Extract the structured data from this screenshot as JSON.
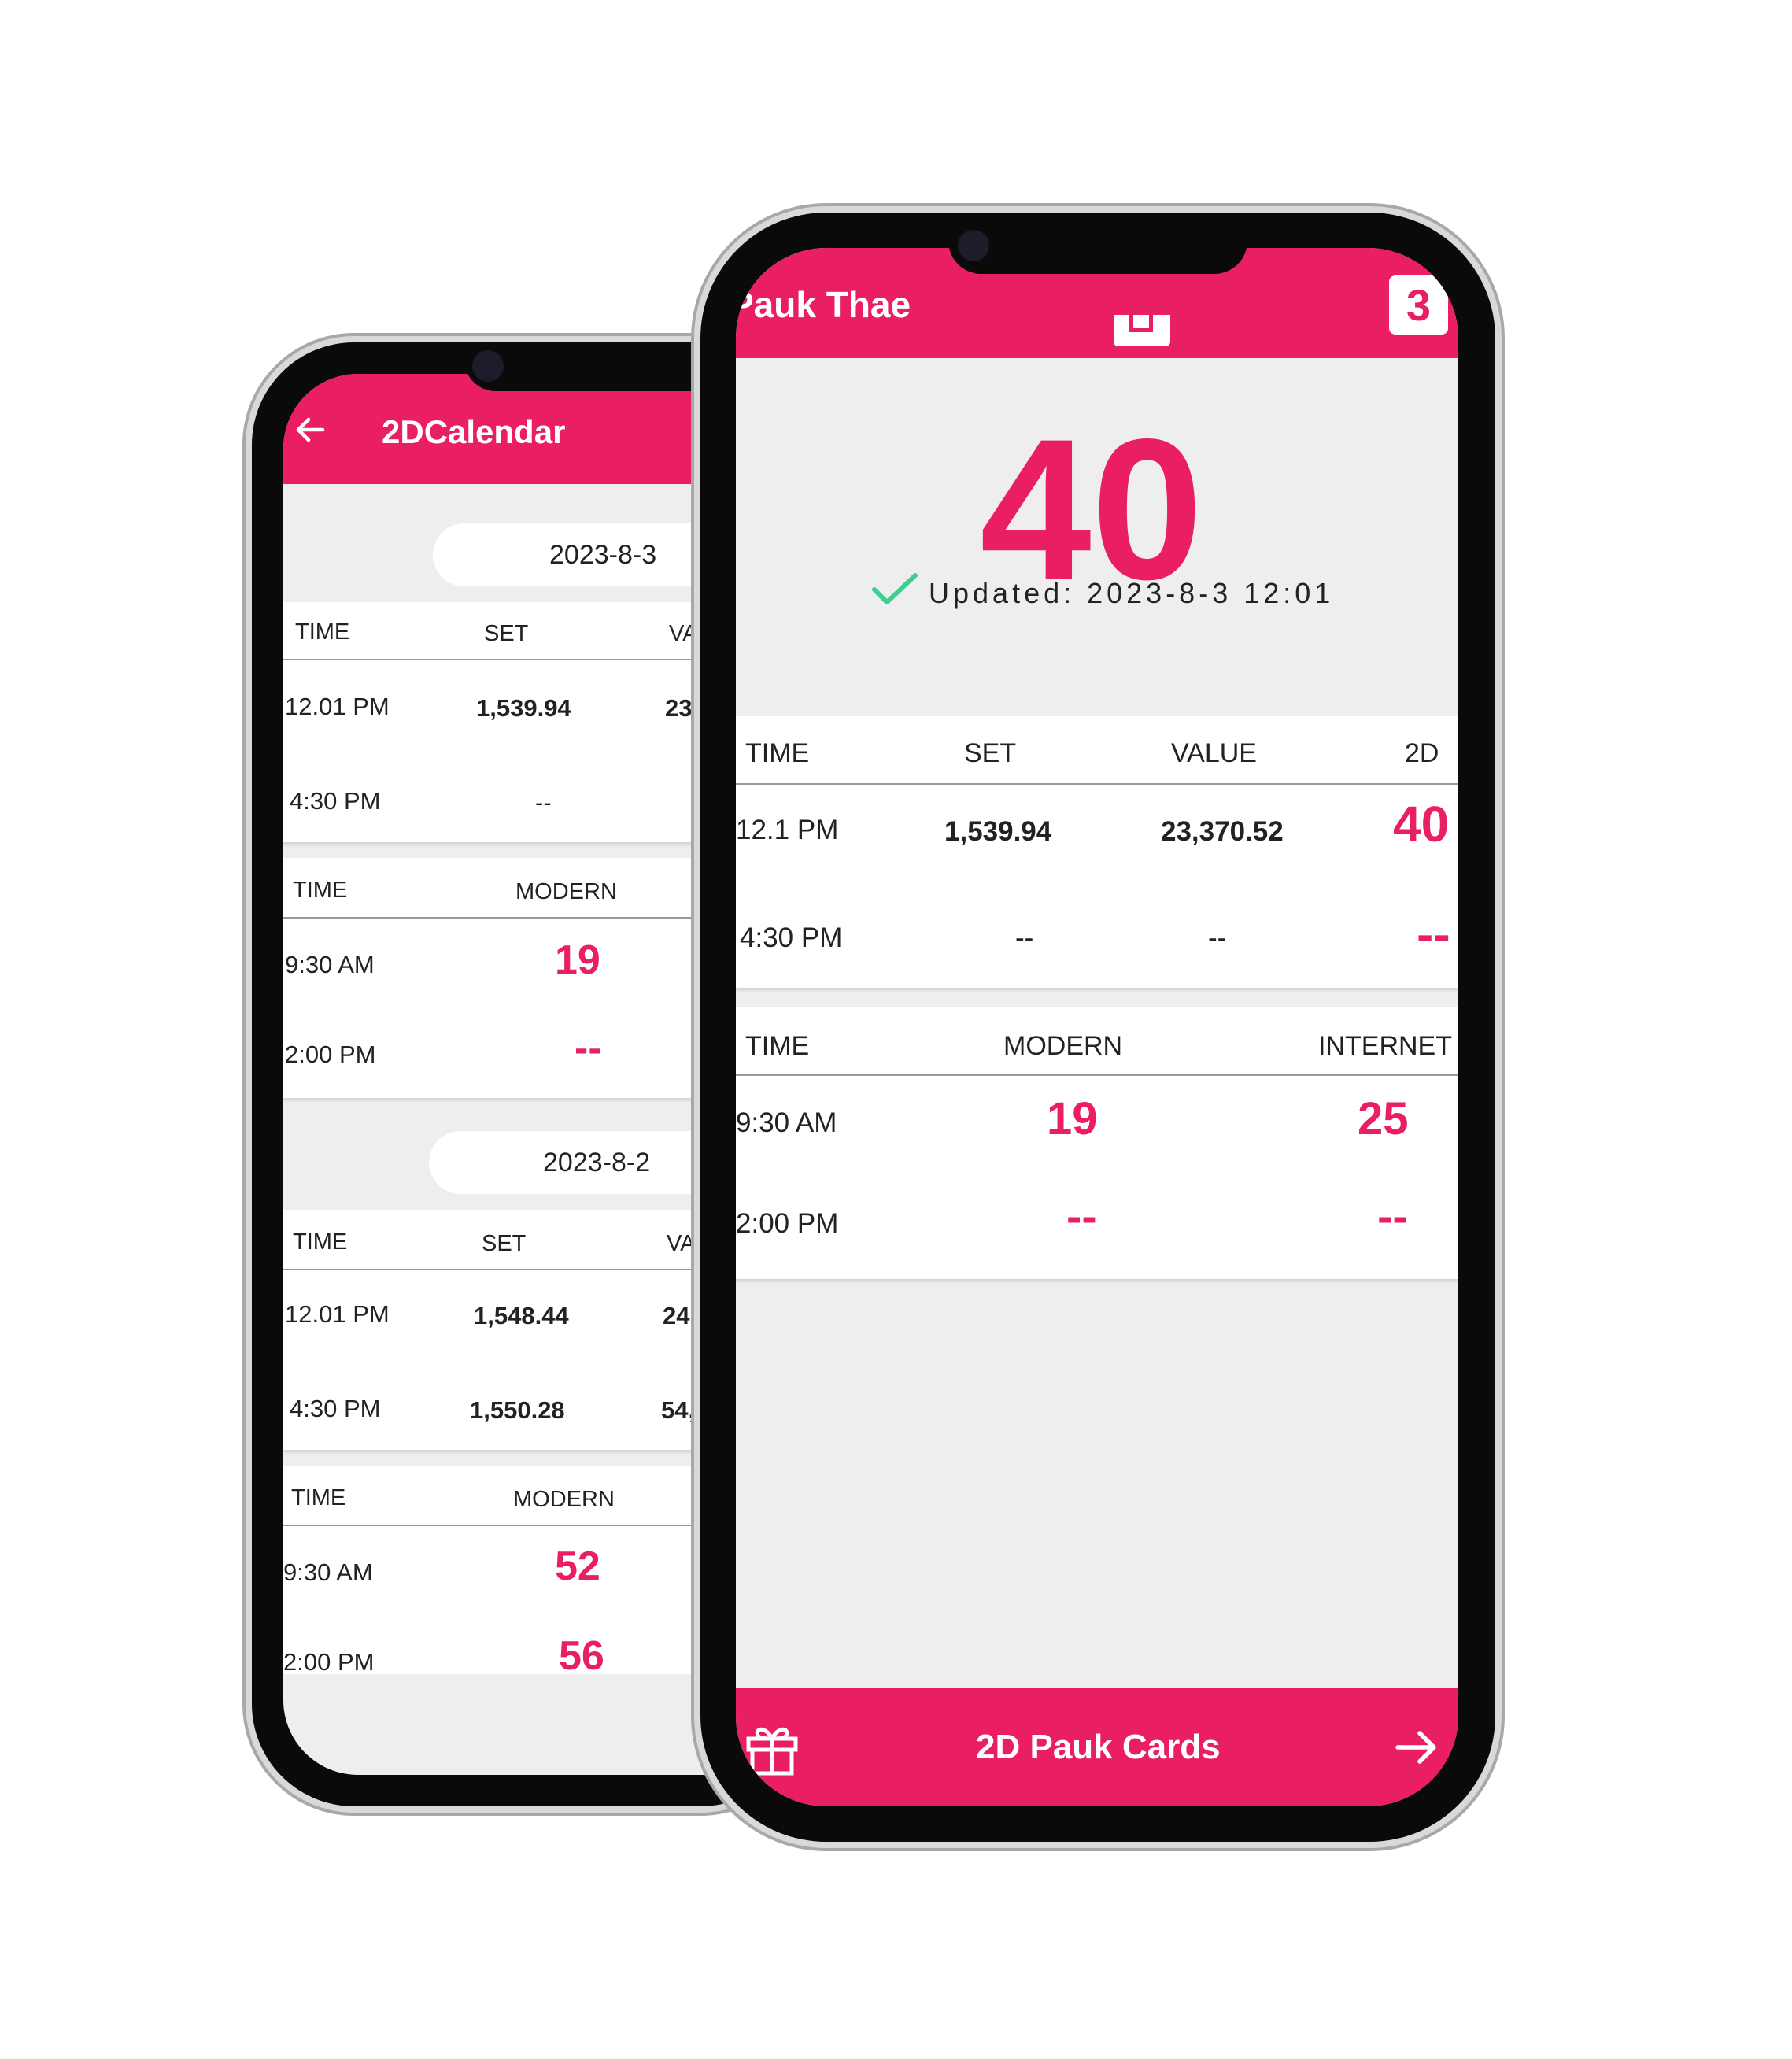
{
  "back_screen": {
    "title": "2DCalendar",
    "days": [
      {
        "date": "2023-8-3",
        "set_headers": [
          "TIME",
          "SET",
          "VA"
        ],
        "set_rows": [
          {
            "time": "12.01 PM",
            "set": "1,539.94",
            "value": "23"
          },
          {
            "time": "4:30 PM",
            "set": "--",
            "value": ""
          }
        ],
        "modern_headers": [
          "TIME",
          "MODERN"
        ],
        "modern_rows": [
          {
            "time": "9:30 AM",
            "modern": "19"
          },
          {
            "time": "2:00 PM",
            "modern": "--"
          }
        ]
      },
      {
        "date": "2023-8-2",
        "set_headers": [
          "TIME",
          "SET",
          "VA"
        ],
        "set_rows": [
          {
            "time": "12.01 PM",
            "set": "1,548.44",
            "value": "24,"
          },
          {
            "time": "4:30 PM",
            "set": "1,550.28",
            "value": "54,"
          }
        ],
        "modern_headers": [
          "TIME",
          "MODERN"
        ],
        "modern_rows": [
          {
            "time": "9:30 AM",
            "modern": "52"
          },
          {
            "time": "2:00 PM",
            "modern": "56"
          }
        ]
      }
    ]
  },
  "front_screen": {
    "title": "Pauk Thae",
    "main_number": "40",
    "updated_text": "Updated: 2023-8-3 12:01",
    "set_headers": [
      "TIME",
      "SET",
      "VALUE",
      "2D"
    ],
    "set_rows": [
      {
        "time": "12.1 PM",
        "set": "1,539.94",
        "value": "23,370.52",
        "two_d": "40"
      },
      {
        "time": "4:30 PM",
        "set": "--",
        "value": "--",
        "two_d": "--"
      }
    ],
    "modern_headers": [
      "TIME",
      "MODERN",
      "INTERNET"
    ],
    "modern_rows": [
      {
        "time": "9:30 AM",
        "modern": "19",
        "internet": "25"
      },
      {
        "time": "2:00 PM",
        "modern": "--",
        "internet": "--"
      }
    ],
    "bottom_button_label": "2D Pauk Cards",
    "icons": [
      "back-arrow-icon",
      "check-icon",
      "gift-icon",
      "arrow-right-icon",
      "calendar-icon",
      "badge-3-icon"
    ]
  },
  "colors": {
    "accent": "#e91e63",
    "check": "#3ecf8e",
    "background": "#eeeeee"
  }
}
